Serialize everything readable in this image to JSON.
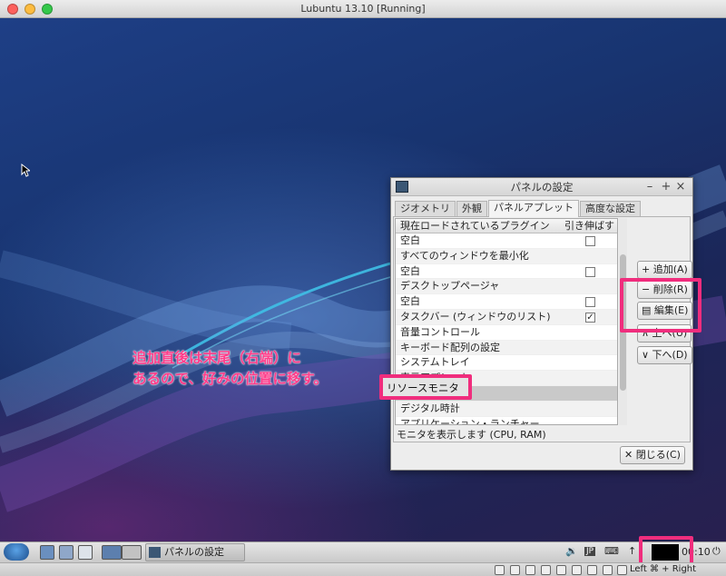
{
  "window": {
    "title": "Lubuntu 13.10 [Running]"
  },
  "annotation": {
    "line1": "追加直後は末尾（右端）に",
    "line2": "あるので、好みの位置に移す。"
  },
  "dialog": {
    "title": "パネルの設定",
    "tabs": [
      "ジオメトリ",
      "外観",
      "パネルアプレット",
      "高度な設定"
    ],
    "active_tab": "パネルアプレット",
    "list_header": {
      "name": "現在ロードされているプラグイン",
      "stretch": "引き伸ばす"
    },
    "plugins": [
      {
        "name": "空白",
        "stretch": false
      },
      {
        "name": "すべてのウィンドウを最小化",
        "stretch": null
      },
      {
        "name": "空白",
        "stretch": false
      },
      {
        "name": "デスクトップページャ",
        "stretch": null
      },
      {
        "name": "空白",
        "stretch": false
      },
      {
        "name": "タスクバー (ウィンドウのリスト)",
        "stretch": true
      },
      {
        "name": "音量コントロール",
        "stretch": null
      },
      {
        "name": "キーボード配列の設定",
        "stretch": null
      },
      {
        "name": "システムトレイ",
        "stretch": null
      },
      {
        "name": "表示アプレット",
        "stretch": null
      },
      {
        "name": "リソースモニタ",
        "stretch": null,
        "selected": true
      },
      {
        "name": "デジタル時計",
        "stretch": null
      },
      {
        "name": "アプリケーション・ランチャー",
        "stretch": null
      }
    ],
    "description": "モニタを表示します (CPU, RAM)",
    "buttons": {
      "add": "+ 追加(A)",
      "remove": "− 削除(R)",
      "edit": "編集(E)",
      "up": "∧ 上へ(U)",
      "down": "∨ 下へ(D)",
      "close": "✕ 閉じる(C)"
    },
    "selected_overlay": "リソースモニタ"
  },
  "taskbar": {
    "task_label": "パネルの設定",
    "tray_jp": "JP",
    "clock": "00:10"
  },
  "vbox_status": {
    "host_key": "Left ⌘ + Right"
  },
  "colors": {
    "highlight": "#f02d7d",
    "annotation": "#ff3d8a"
  }
}
